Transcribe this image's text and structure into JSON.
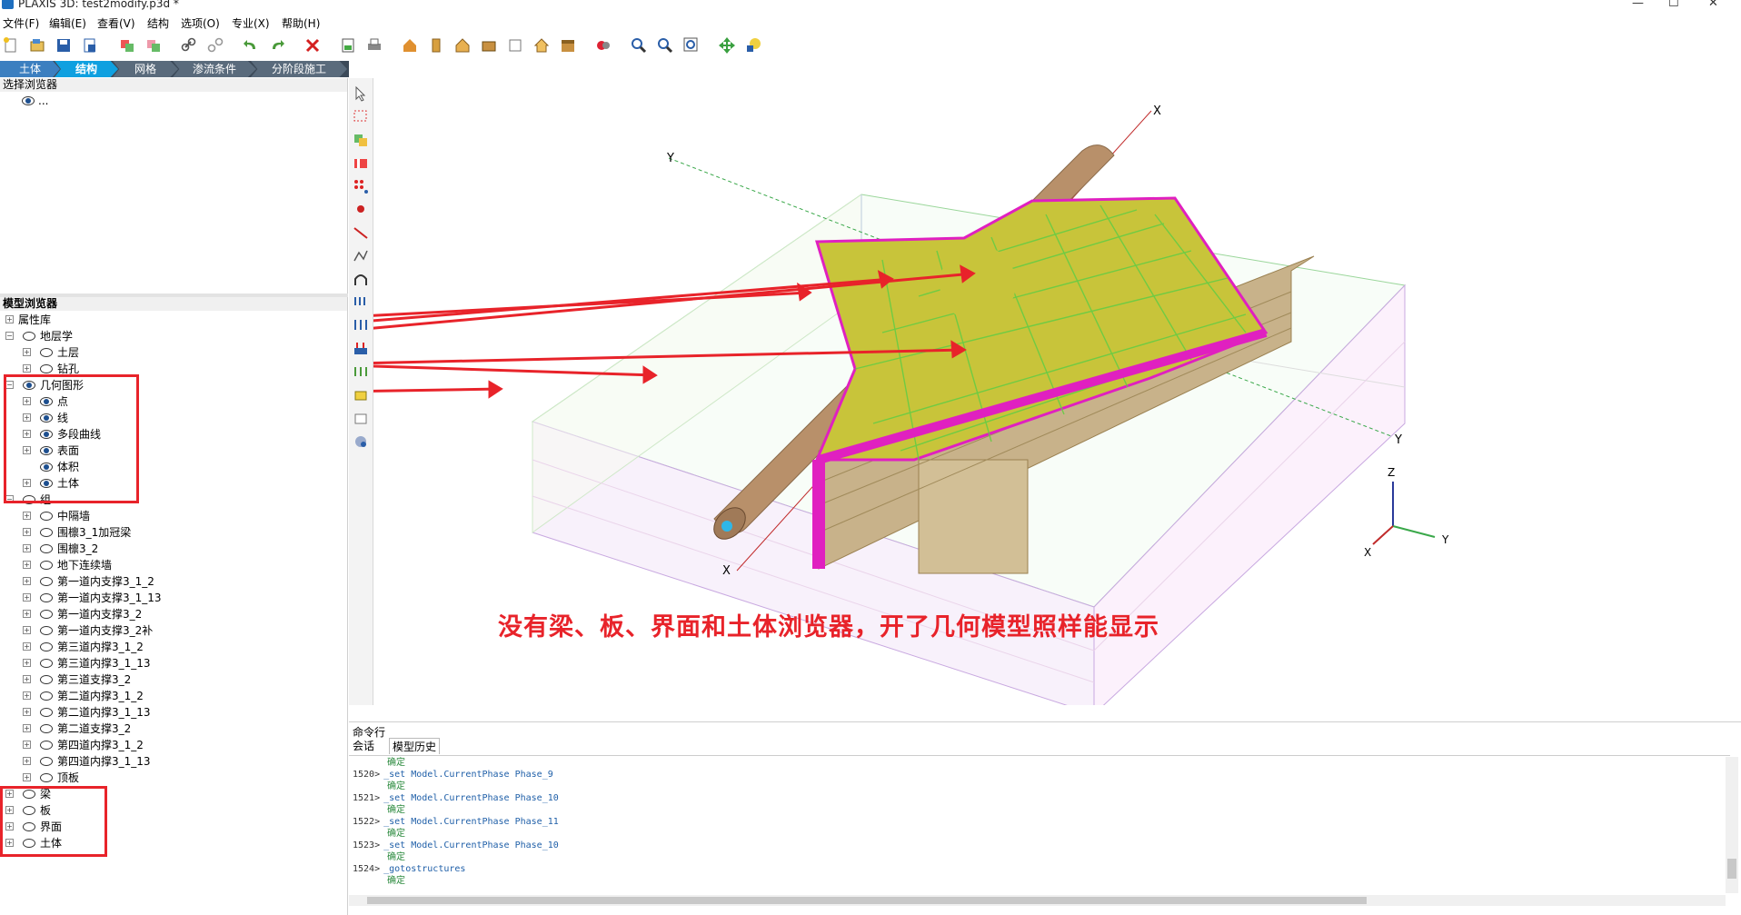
{
  "window": {
    "title": "PLAXIS 3D: test2modify.p3d *",
    "min": "—",
    "max": "☐",
    "close": "✕"
  },
  "menu": [
    "文件(F)",
    "编辑(E)",
    "查看(V)",
    "结构",
    "选项(O)",
    "专业(X)",
    "帮助(H)"
  ],
  "tabs": [
    "土体",
    "结构",
    "网格",
    "渗流条件",
    "分阶段施工"
  ],
  "active_tab": "结构",
  "selection_browser": {
    "title": "选择浏览器",
    "item": "..."
  },
  "model_browser": {
    "title": "模型浏览器",
    "items": [
      {
        "label": "属性库",
        "indent": 0,
        "eye": null,
        "exp": "+"
      },
      {
        "label": "地层学",
        "indent": 0,
        "eye": "off",
        "exp": "−"
      },
      {
        "label": "土层",
        "indent": 1,
        "eye": "off",
        "exp": "+"
      },
      {
        "label": "钻孔",
        "indent": 1,
        "eye": "off",
        "exp": "+"
      },
      {
        "label": "几何图形",
        "indent": 0,
        "eye": "on",
        "exp": "−"
      },
      {
        "label": "点",
        "indent": 1,
        "eye": "on",
        "exp": "+"
      },
      {
        "label": "线",
        "indent": 1,
        "eye": "on",
        "exp": "+"
      },
      {
        "label": "多段曲线",
        "indent": 1,
        "eye": "on",
        "exp": "+"
      },
      {
        "label": "表面",
        "indent": 1,
        "eye": "on",
        "exp": "+"
      },
      {
        "label": "体积",
        "indent": 1,
        "eye": "on",
        "exp": null
      },
      {
        "label": "土体",
        "indent": 1,
        "eye": "on",
        "exp": "+"
      },
      {
        "label": "组",
        "indent": 0,
        "eye": "off",
        "exp": "−"
      },
      {
        "label": "中隔墙",
        "indent": 1,
        "eye": "off",
        "exp": "+"
      },
      {
        "label": "围檩3_1加冠梁",
        "indent": 1,
        "eye": "off",
        "exp": "+"
      },
      {
        "label": "围檩3_2",
        "indent": 1,
        "eye": "off",
        "exp": "+"
      },
      {
        "label": "地下连续墙",
        "indent": 1,
        "eye": "off",
        "exp": "+"
      },
      {
        "label": "第一道内支撑3_1_2",
        "indent": 1,
        "eye": "off",
        "exp": "+"
      },
      {
        "label": "第一道内支撑3_1_13",
        "indent": 1,
        "eye": "off",
        "exp": "+"
      },
      {
        "label": "第一道内支撑3_2",
        "indent": 1,
        "eye": "off",
        "exp": "+"
      },
      {
        "label": "第一道内支撑3_2补",
        "indent": 1,
        "eye": "off",
        "exp": "+"
      },
      {
        "label": "第三道内撑3_1_2",
        "indent": 1,
        "eye": "off",
        "exp": "+"
      },
      {
        "label": "第三道内撑3_1_13",
        "indent": 1,
        "eye": "off",
        "exp": "+"
      },
      {
        "label": "第三道支撑3_2",
        "indent": 1,
        "eye": "off",
        "exp": "+"
      },
      {
        "label": "第二道内撑3_1_2",
        "indent": 1,
        "eye": "off",
        "exp": "+"
      },
      {
        "label": "第二道内撑3_1_13",
        "indent": 1,
        "eye": "off",
        "exp": "+"
      },
      {
        "label": "第二道支撑3_2",
        "indent": 1,
        "eye": "off",
        "exp": "+"
      },
      {
        "label": "第四道内撑3_1_2",
        "indent": 1,
        "eye": "off",
        "exp": "+"
      },
      {
        "label": "第四道内撑3_1_13",
        "indent": 1,
        "eye": "off",
        "exp": "+"
      },
      {
        "label": "顶板",
        "indent": 1,
        "eye": "off",
        "exp": "+"
      },
      {
        "label": "梁",
        "indent": 0,
        "eye": "off",
        "exp": "+"
      },
      {
        "label": "板",
        "indent": 0,
        "eye": "off",
        "exp": "+"
      },
      {
        "label": "界面",
        "indent": 0,
        "eye": "off",
        "exp": "+"
      },
      {
        "label": "土体",
        "indent": 0,
        "eye": "off",
        "exp": "+"
      }
    ]
  },
  "viewport": {
    "axis_x": "X",
    "axis_y": "Y",
    "axis_z": "Z",
    "gizmo_z": "Z",
    "gizmo_y": "Y",
    "gizmo_x": "X"
  },
  "annotation": "没有梁、板、界面和土体浏览器，开了几何模型照样能显示",
  "command": {
    "title": "命令行",
    "tabs": [
      "会话",
      "模型历史"
    ],
    "log": [
      {
        "num": "",
        "cmd": "",
        "ok": "确定"
      },
      {
        "num": "1520>",
        "cmd": "_set Model.CurrentPhase Phase_9",
        "ok": "确定"
      },
      {
        "num": "1521>",
        "cmd": "_set Model.CurrentPhase Phase_10",
        "ok": "确定"
      },
      {
        "num": "1522>",
        "cmd": "_set Model.CurrentPhase Phase_11",
        "ok": "确定"
      },
      {
        "num": "1523>",
        "cmd": "_set Model.CurrentPhase Phase_10",
        "ok": "确定"
      },
      {
        "num": "1524>",
        "cmd": "_gotostructures",
        "ok": "确定"
      }
    ]
  },
  "colors": {
    "accent": "#3c7fc0",
    "tab_bg": "#3c4a59",
    "annotation": "#e8232a",
    "surface": "#c8c43a",
    "plate": "#e020c0",
    "soil": "#c8b28a",
    "mesh": "#66cc44"
  }
}
